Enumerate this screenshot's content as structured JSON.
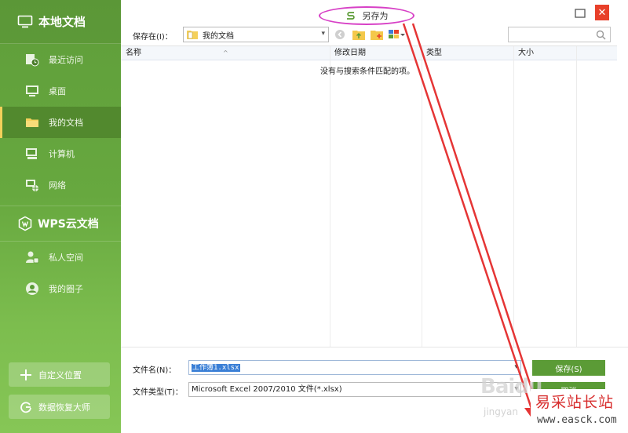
{
  "sidebar": {
    "local_header": "本地文档",
    "items": [
      {
        "label": "最近访问",
        "icon": "recent-icon"
      },
      {
        "label": "桌面",
        "icon": "desktop-icon"
      },
      {
        "label": "我的文档",
        "icon": "folder-icon",
        "active": true
      },
      {
        "label": "计算机",
        "icon": "computer-icon"
      },
      {
        "label": "网络",
        "icon": "network-icon"
      }
    ],
    "wps_header": "WPS云文档",
    "cloud_items": [
      {
        "label": "私人空间",
        "icon": "private-space-icon"
      },
      {
        "label": "我的圈子",
        "icon": "circle-icon"
      }
    ],
    "custom_location_button": "自定义位置",
    "recovery_button": "数据恢复大师"
  },
  "dialog": {
    "title": "另存为",
    "save_in_label": "保存在(I)：",
    "location": "我的文档",
    "search_placeholder": "",
    "columns": [
      "名称",
      "修改日期",
      "类型",
      "大小"
    ],
    "empty_message": "没有与搜索条件匹配的项。",
    "filename_label": "文件名(N)：",
    "filename_value": "工作簿1.xlsx",
    "filetype_label": "文件类型(T)：",
    "filetype_value": "Microsoft Excel 2007/2010 文件(*.xlsx)",
    "save_button": "保存(S)",
    "cancel_button": "取消"
  },
  "colors": {
    "accent": "#5b9b36",
    "sidebar_top": "#5f9e3a",
    "sidebar_bottom": "#86c656",
    "close": "#e8402a",
    "annotation": "#d740c6",
    "arrow": "#e53535"
  },
  "watermark": {
    "baidu": "Baidu",
    "jingyan": "jingyan",
    "site_title": "易采站长站",
    "site_url": "www.easck.com"
  }
}
